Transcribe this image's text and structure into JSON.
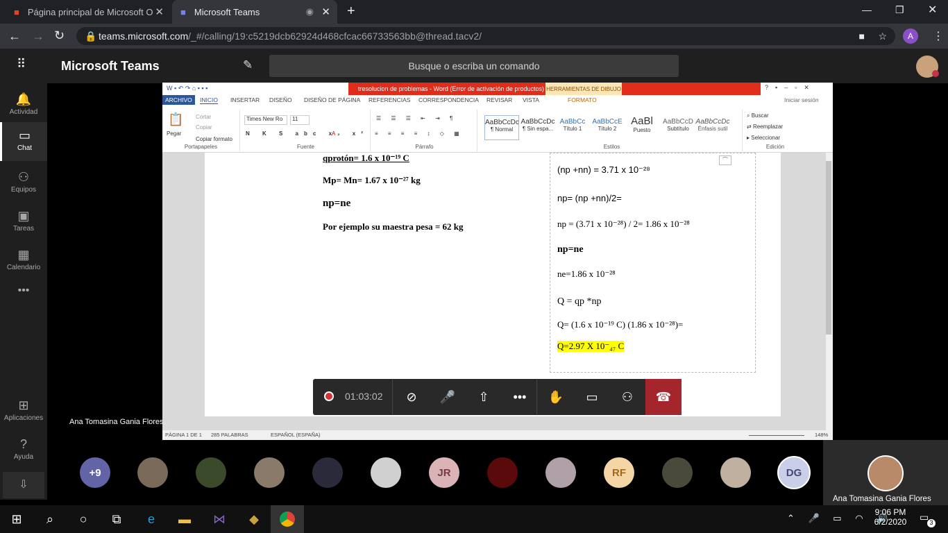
{
  "browser": {
    "tabs": [
      {
        "title": "Página principal de Microsoft Offi",
        "close": "✕"
      },
      {
        "title": "Microsoft Teams",
        "close": "✕"
      }
    ],
    "new_tab": "+",
    "url_host": "teams.microsoft.com",
    "url_path": "/_#/calling/19:c5219dcb62924d468cfcac66733563bb@thread.tacv2/",
    "profile_initial": "A"
  },
  "teams": {
    "app_title": "Microsoft Teams",
    "search_placeholder": "Busque o escriba un comando",
    "rail": [
      {
        "label": "Actividad",
        "icon": "bell-icon"
      },
      {
        "label": "Chat",
        "icon": "chat-icon"
      },
      {
        "label": "Equipos",
        "icon": "teams-icon"
      },
      {
        "label": "Tareas",
        "icon": "tasks-icon"
      },
      {
        "label": "Calendario",
        "icon": "calendar-icon"
      },
      {
        "label": "•••",
        "icon": "more-icon"
      },
      {
        "label": "Aplicaciones",
        "icon": "apps-icon"
      },
      {
        "label": "Ayuda",
        "icon": "help-icon"
      }
    ],
    "presenter_name": "Ana Tomasina Gania Flores",
    "self_name": "Ana Tomasina Gania Flores",
    "call_timer": "01:03:02",
    "participants": [
      "+9",
      "",
      "",
      "",
      "",
      "",
      "JR",
      "",
      "",
      "RF",
      "",
      "",
      "DG"
    ]
  },
  "word": {
    "title": "tresolucion de problemas -  Word (Error de activación de productos)",
    "drawing_tools": "HERRAMIENTAS DE DIBUJO",
    "signin": "Iniciar sesión",
    "tabs": [
      "ARCHIVO",
      "INICIO",
      "INSERTAR",
      "DISEÑO",
      "DISEÑO DE PÁGINA",
      "REFERENCIAS",
      "CORRESPONDENCIA",
      "REVISAR",
      "VISTA",
      "FORMATO"
    ],
    "clipboard": {
      "paste": "Pegar",
      "cut": "Cortar",
      "copy": "Copiar",
      "format": "Copiar formato",
      "label": "Portapapeles"
    },
    "font": {
      "name": "Times New Ro",
      "size": "11",
      "label": "Fuente"
    },
    "paragraph_label": "Párrafo",
    "styles_label": "Estilos",
    "styles": [
      {
        "sample": "AaBbCcDc",
        "name": "¶ Normal"
      },
      {
        "sample": "AaBbCcDc",
        "name": "¶ Sin espa..."
      },
      {
        "sample": "AaBbCc",
        "name": "Título 1"
      },
      {
        "sample": "AaBbCcE",
        "name": "Título 2"
      },
      {
        "sample": "AaBl",
        "name": "Puesto"
      },
      {
        "sample": "AaBbCcD",
        "name": "Subtítulo"
      },
      {
        "sample": "AaBbCcDc",
        "name": "Énfasis sutil"
      }
    ],
    "editing": {
      "find": "Buscar",
      "replace": "Reemplazar",
      "select": "Seleccionar",
      "label": "Edición"
    },
    "status": {
      "page": "PÁGINA 1 DE 1",
      "words": "285 PALABRAS",
      "lang": "ESPAÑOL (ESPAÑA)",
      "zoom": "148%"
    },
    "doc_left": [
      "qprotón= 1.6 x 10⁻¹⁹ C",
      "Mp= Mn= 1.67 x 10⁻²⁷ kg",
      "np=ne",
      "Por ejemplo su maestra pesa = 62 kg"
    ],
    "doc_right": [
      "(np +nn) = 3.71 x 10⁻²⁸",
      "np= (np +nn)/2=",
      "np = (3.71 x 10⁻²⁸) / 2= 1.86 x 10⁻²⁸",
      "np=ne",
      "ne=1.86 x 10⁻²⁸",
      "Q =  qp *np",
      "Q= (1.6 x 10⁻¹⁹ C) (1.86 x 10⁻²⁸)=",
      "Q=2.97 X 10⁻₄₇ C"
    ]
  },
  "taskbar": {
    "time": "9:06 PM",
    "date": "6/2/2020",
    "notif": "3"
  }
}
